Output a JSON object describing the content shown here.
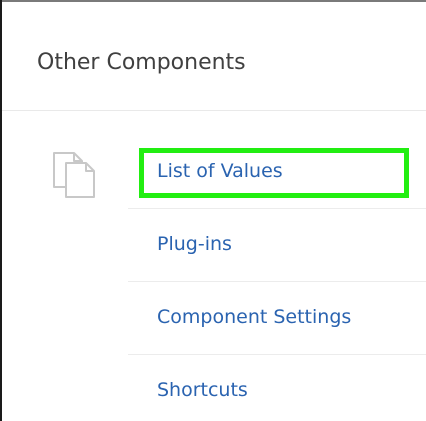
{
  "panel": {
    "title": "Other Components",
    "icon": "copy-pages-icon"
  },
  "components": {
    "items": [
      {
        "label": "List of Values",
        "highlighted": true
      },
      {
        "label": "Plug-ins",
        "highlighted": false
      },
      {
        "label": "Component Settings",
        "highlighted": false
      },
      {
        "label": "Shortcuts",
        "highlighted": false
      }
    ]
  },
  "colors": {
    "link": "#2a63b0",
    "title": "#404040",
    "highlight": "#22ee11",
    "icon_stroke": "#c8c8c8",
    "divider": "#ececec"
  }
}
